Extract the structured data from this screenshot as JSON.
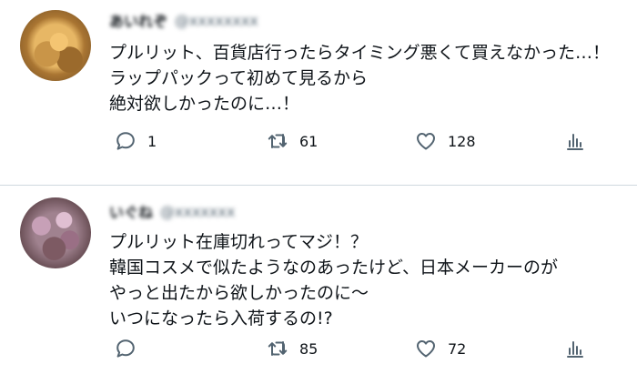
{
  "tweets": [
    {
      "display_name": "あいれぞ",
      "handle": "@xxxxxxxx",
      "avatar_icon": "profile-photo",
      "lines": [
        "プルリット、百貨店行ったらタイミング悪くて買えなかった…！",
        "ラップパックって初めて見るから",
        "絶対欲しかったのに…！"
      ],
      "reply_count": "1",
      "retweet_count": "61",
      "like_count": "128"
    },
    {
      "display_name": "いぐね",
      "handle": "@xxxxxxx",
      "avatar_icon": "profile-photo",
      "lines": [
        "プルリット在庫切れってマジ！？",
        "韓国コスメで似たようなのあったけど、日本メーカーのが",
        "やっと出たから欲しかったのに〜",
        "いつになったら入荷するの!?"
      ],
      "reply_count": "",
      "retweet_count": "85",
      "like_count": "72"
    }
  ],
  "icons": {
    "reply": "reply-icon",
    "retweet": "retweet-icon",
    "like": "heart-icon",
    "share": "analytics-icon"
  },
  "colors": {
    "text": "#0f1419",
    "muted": "#536471",
    "divider": "#cfd9de",
    "background": "#ffffff"
  }
}
